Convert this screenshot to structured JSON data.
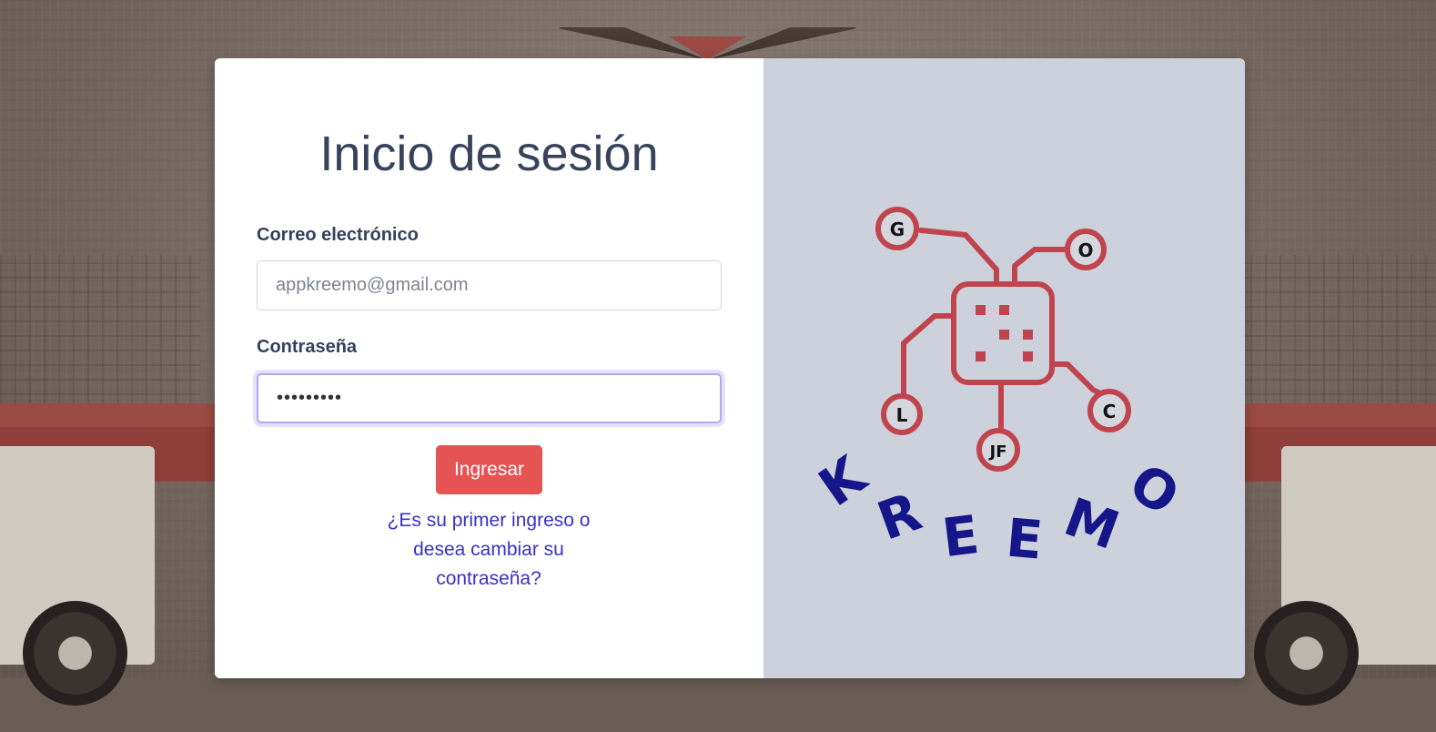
{
  "login": {
    "title": "Inicio de sesión",
    "email_label": "Correo electrónico",
    "email_placeholder": "appkreemo@gmail.com",
    "email_value": "",
    "password_label": "Contraseña",
    "password_value": "•••••••••",
    "submit_label": "Ingresar",
    "first_login_link": "¿Es su primer ingreso o desea cambiar su contraseña?"
  },
  "logo": {
    "brand_name": "KREEMO",
    "brand_letters": [
      "K",
      "R",
      "E",
      "E",
      "M",
      "O"
    ],
    "nodes": [
      "G",
      "O",
      "L",
      "JF",
      "C"
    ],
    "circuit_color": "#c0444e",
    "text_color": "#14168a"
  }
}
